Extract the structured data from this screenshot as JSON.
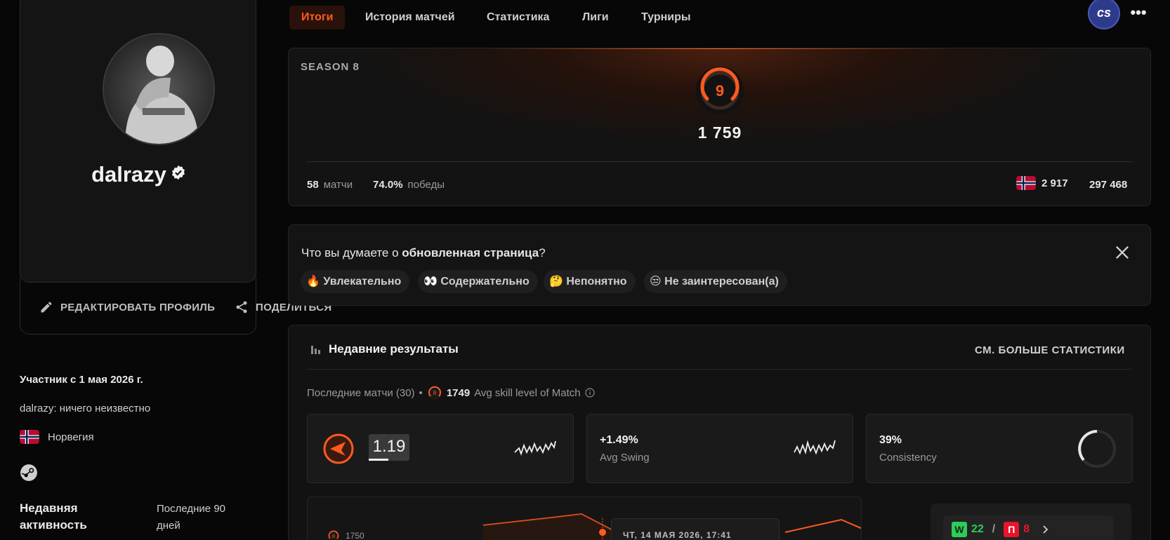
{
  "nav": {
    "tabs": [
      {
        "label": "Итоги",
        "active": true
      },
      {
        "label": "История матчей"
      },
      {
        "label": "Статистика"
      },
      {
        "label": "Лиги"
      },
      {
        "label": "Турниры"
      }
    ],
    "game_badge": "cs",
    "more_icon": "more-horizontal-icon"
  },
  "profile": {
    "username": "dalrazy",
    "edit_label": "РЕДАКТИРОВАТЬ ПРОФИЛЬ",
    "share_label": "ПОДЕЛИТЬСЯ",
    "member_since": "Участник с 1 мая 2026 г.",
    "bio": "dalrazy: ничего неизвестно",
    "country": "Норвегия",
    "activity_label": "Недавняя активность",
    "activity_value": "Последние 90 дней"
  },
  "season": {
    "label": "SEASON 8",
    "level": "9",
    "elo": "1 759",
    "matches_value": "58",
    "matches_label": "матчи",
    "winrate_value": "74.0%",
    "winrate_label": "победы",
    "country_rank": "2 917",
    "global_rank": "297 468"
  },
  "feedback": {
    "question_prefix": "Что вы думаете о ",
    "question_bold": "обновленная страница",
    "question_suffix": "?",
    "options": [
      {
        "emoji": "🔥",
        "label": "Увлекательно"
      },
      {
        "emoji": "👀",
        "label": "Содержательно"
      },
      {
        "emoji": "🤔",
        "label": "Непонятно"
      },
      {
        "emoji": "😒",
        "label": "Не заинтересован(а)"
      }
    ]
  },
  "recent": {
    "title": "Недавние результаты",
    "more_link": "СМ. БОЛЬШЕ СТАТИСТИКИ",
    "last_matches": "Последние матчи (30)",
    "avg_level_badge": "8",
    "avg_elo": "1749",
    "avg_label": "Avg skill level of Match",
    "cards": [
      {
        "value": "1.19"
      },
      {
        "value": "+1.49%",
        "label": "Avg Swing"
      },
      {
        "value": "39%",
        "label": "Consistency"
      }
    ],
    "chart_badge": "8",
    "chart_tick": "1750",
    "tooltip_date": "ЧТ, 14 МАЯ 2026, 17:41",
    "win_letter": "W",
    "wins": "22",
    "loss_letter": "П",
    "losses": "8",
    "wl_separator": "/"
  },
  "colors": {
    "accent": "#ff5a1f",
    "win": "#2ecc59",
    "loss": "#e8132d",
    "background": "#070707"
  }
}
